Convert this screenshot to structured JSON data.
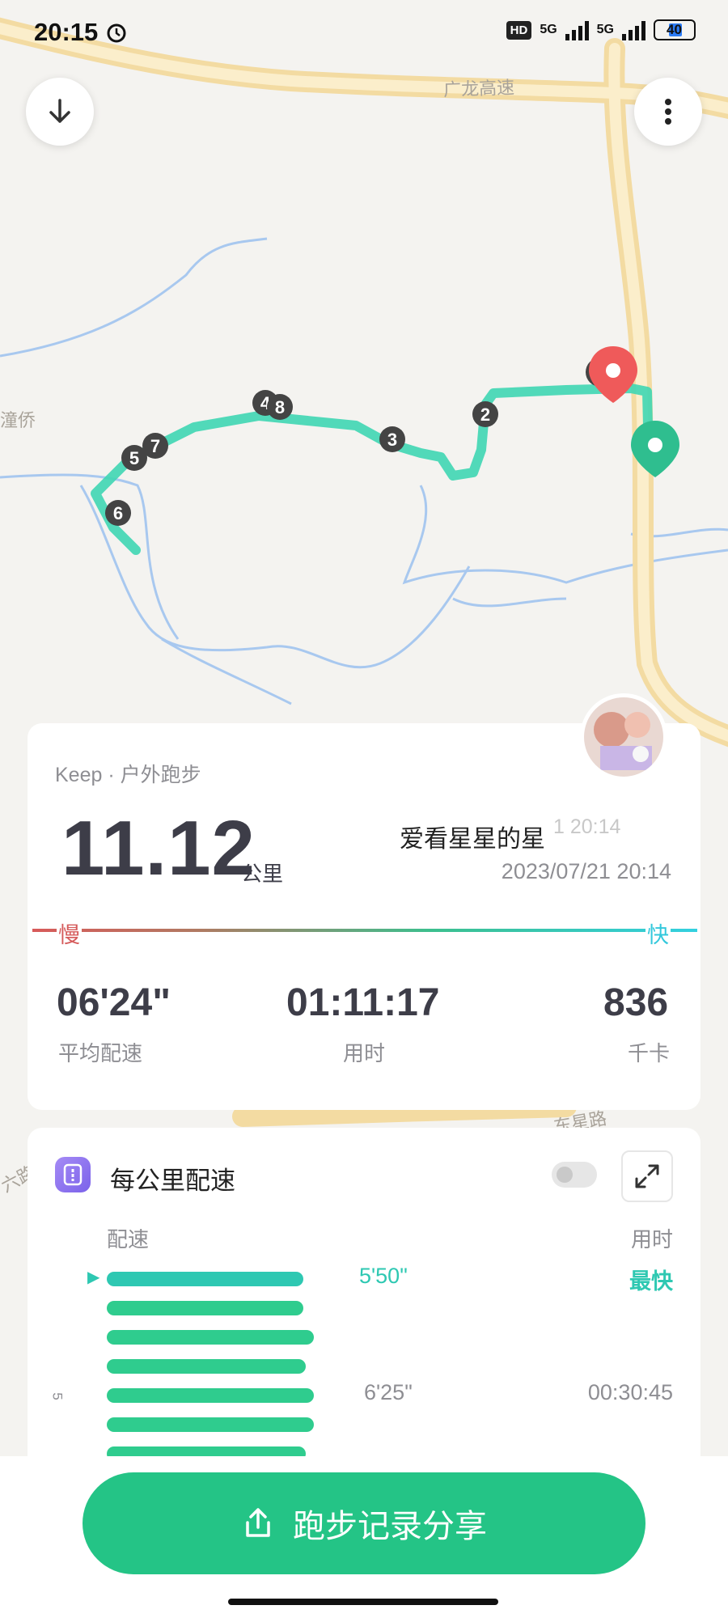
{
  "status_bar": {
    "time": "20:15",
    "hd_badge": "HD",
    "network_1": "5G",
    "network_2": "5G",
    "battery": "40"
  },
  "map": {
    "road_label_1": "广龙高速",
    "place_label_1": "潼侨",
    "road_label_2": "东星路",
    "road_label_3": "六路",
    "route_markers": [
      "6",
      "5",
      "7",
      "4",
      "8",
      "3",
      "2",
      "11"
    ],
    "route_color": "#3fd6b3",
    "end_pin_color": "#ef5a5a",
    "start_pin_color": "#2fbe8f"
  },
  "summary": {
    "source": "Keep · 户外跑步",
    "distance": "11.12",
    "distance_unit": "公里",
    "user_name": "爱看星星的星",
    "ghost_time": "1 20:14",
    "date": "2023/07/21 20:14",
    "slow_label": "慢",
    "fast_label": "快",
    "metrics": [
      {
        "value": "06'24\"",
        "label": "平均配速"
      },
      {
        "value": "01:11:17",
        "label": "用时"
      },
      {
        "value": "836",
        "label": "千卡"
      }
    ]
  },
  "pace_section": {
    "title": "每公里配速",
    "col_pace": "配速",
    "col_time": "用时",
    "fastest_tag": "最快",
    "km_marker": "5",
    "rows": [
      {
        "pace": "5'50\"",
        "fraction": 0.76,
        "fastest": true
      },
      {
        "pace": "",
        "fraction": 0.76
      },
      {
        "pace": "",
        "fraction": 0.8
      },
      {
        "pace": "",
        "fraction": 0.77
      },
      {
        "pace": "6'25\"",
        "time": "00:30:45",
        "fraction": 0.8
      },
      {
        "pace": "",
        "fraction": 0.8
      },
      {
        "pace": "",
        "fraction": 0.77
      }
    ]
  },
  "share_button": {
    "label": "跑步记录分享"
  }
}
